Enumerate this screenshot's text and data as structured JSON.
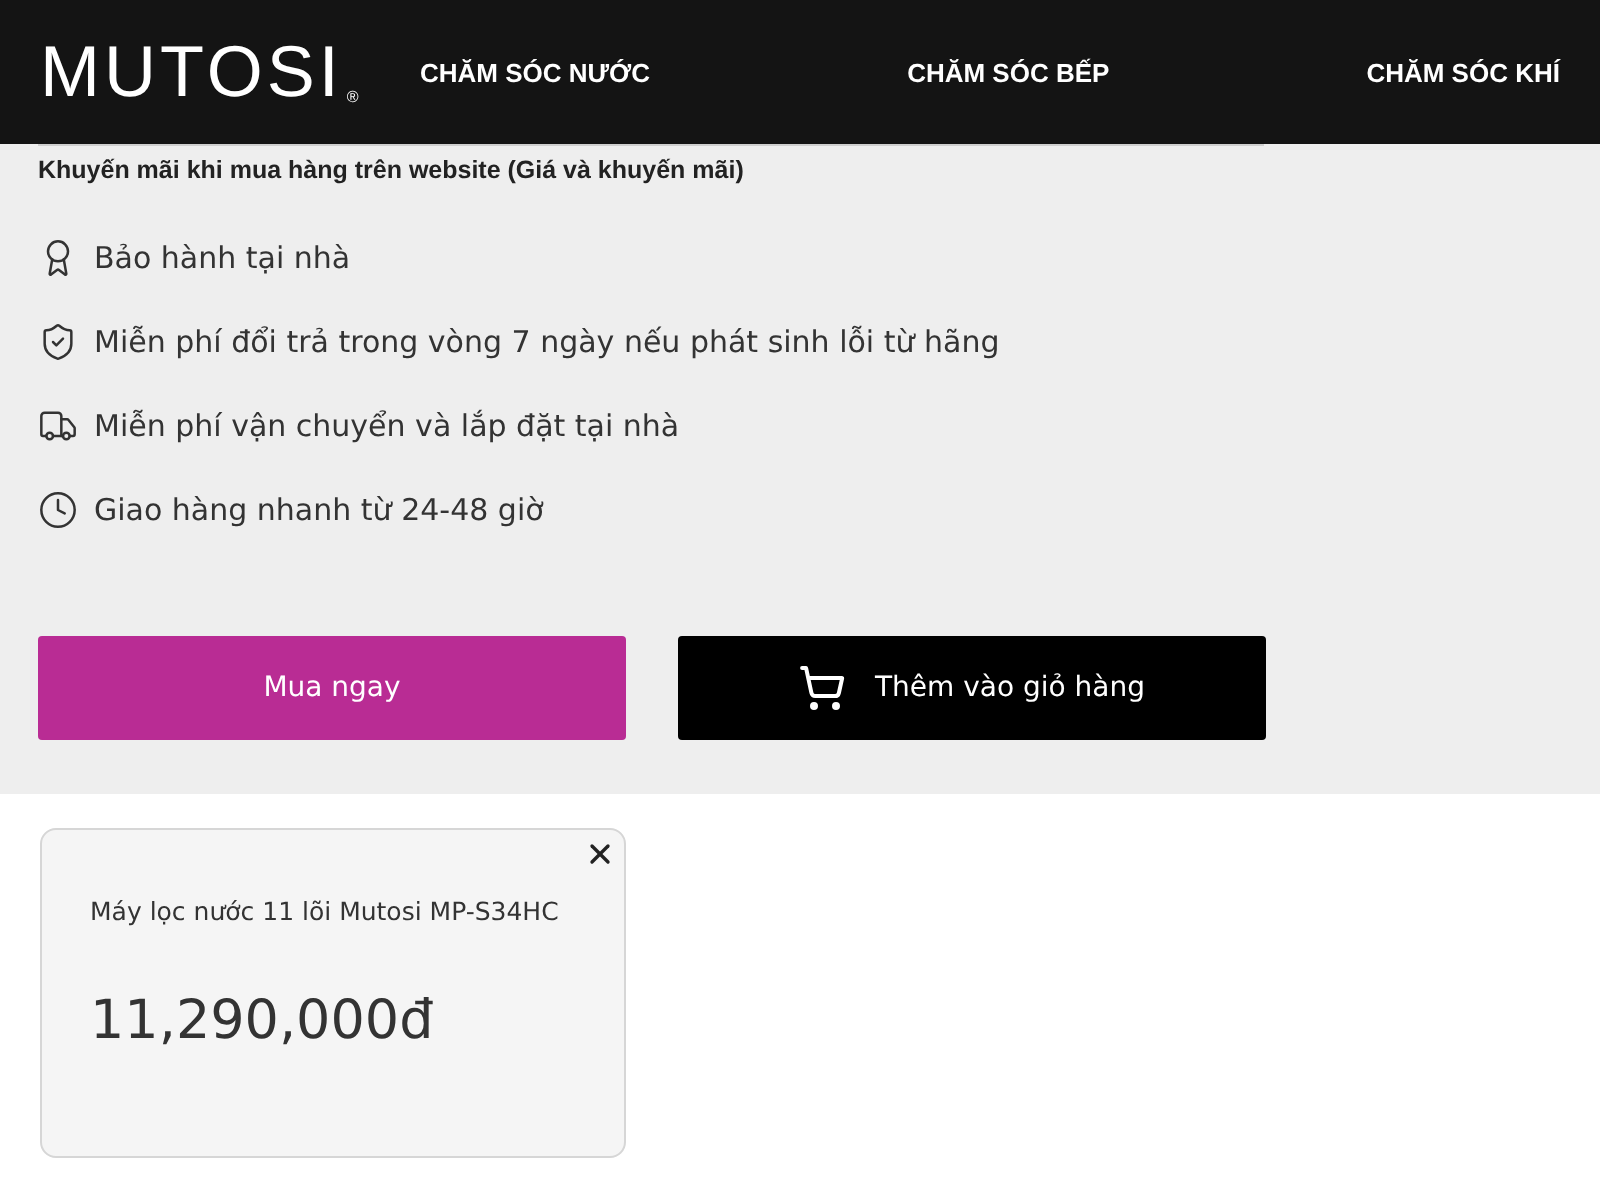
{
  "header": {
    "logo": "MUTOSI",
    "logo_mark": "®",
    "nav": [
      {
        "label": "CHĂM SÓC NƯỚC"
      },
      {
        "label": "CHĂM SÓC BẾP"
      },
      {
        "label": "CHĂM SÓC KHÍ"
      }
    ]
  },
  "promo_title": "Khuyến mãi khi mua hàng trên website (Giá và khuyến mãi)",
  "benefits": [
    {
      "kind": "award",
      "text": "Bảo hành tại nhà"
    },
    {
      "kind": "shield",
      "text": "Miễn phí đổi trả trong vòng 7 ngày nếu phát sinh lỗi từ hãng"
    },
    {
      "kind": "truck",
      "text": "Miễn phí vận chuyển và lắp đặt tại nhà"
    },
    {
      "kind": "clock",
      "text": "Giao hàng nhanh từ 24-48 giờ"
    }
  ],
  "buttons": [
    {
      "kind": "buy",
      "label": "Mua ngay"
    },
    {
      "kind": "cart",
      "label": "Thêm vào giỏ hàng"
    }
  ],
  "popup": {
    "product": "Máy lọc nước 11 lõi Mutosi MP-S34HC",
    "price": "11,290,000đ"
  }
}
